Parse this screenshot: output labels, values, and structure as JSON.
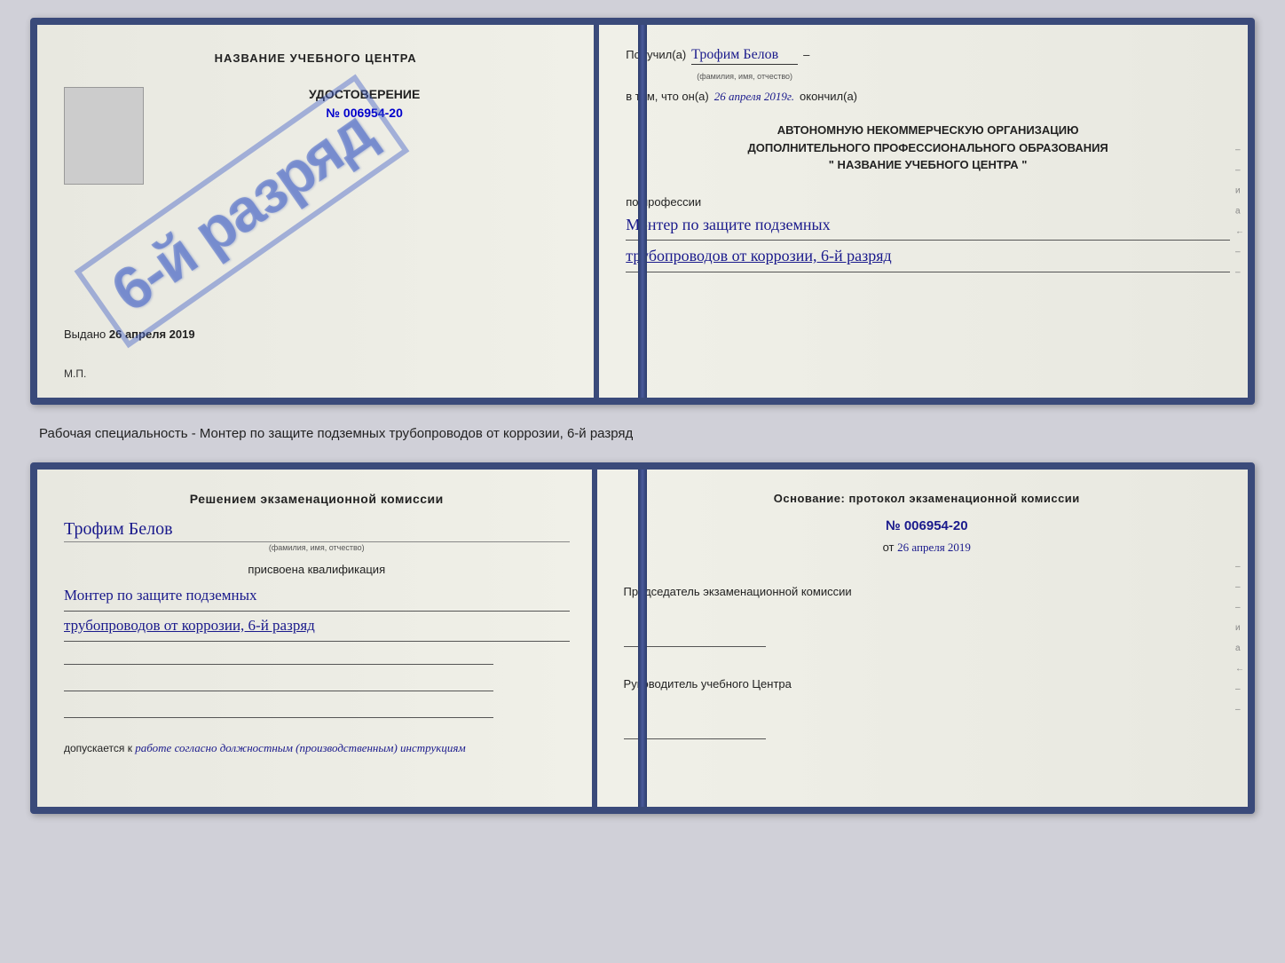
{
  "doc1": {
    "left": {
      "title": "НАЗВАНИЕ УЧЕБНОГО ЦЕНТРА",
      "doc_type": "УДОСТОВЕРЕНИЕ",
      "doc_number_label": "№",
      "doc_number": "006954-20",
      "issued_label": "Выдано",
      "issued_date": "26 апреля 2019",
      "mp_label": "М.П."
    },
    "stamp": {
      "text": "6-й разряд"
    },
    "right": {
      "received_label": "Получил(а)",
      "name": "Трофим Белов",
      "name_annotation": "(фамилия, имя, отчество)",
      "dash": "–",
      "in_that_label": "в том, что он(а)",
      "date": "26 апреля 2019г.",
      "finished_label": "окончил(а)",
      "org_line1": "АВТОНОМНУЮ НЕКОММЕРЧЕСКУЮ ОРГАНИЗАЦИЮ",
      "org_line2": "ДОПОЛНИТЕЛЬНОГО ПРОФЕССИОНАЛЬНОГО ОБРАЗОВАНИЯ",
      "org_line3": "\"   НАЗВАНИЕ УЧЕБНОГО ЦЕНТРА   \"",
      "profession_label": "по профессии",
      "profession1": "Монтер по защите подземных",
      "profession2": "трубопроводов от коррозии, 6-й разряд",
      "edge_marks": [
        "–",
        "–",
        "и",
        "а",
        "←",
        "–",
        "–",
        "–"
      ]
    }
  },
  "separator": {
    "text": "Рабочая специальность - Монтер по защите подземных трубопроводов от коррозии, 6-й разряд"
  },
  "doc2": {
    "left": {
      "commission_label": "Решением экзаменационной комиссии",
      "name": "Трофим Белов",
      "name_annotation": "(фамилия, имя, отчество)",
      "assigned_label": "присвоена квалификация",
      "profession1": "Монтер по защите подземных",
      "profession2": "трубопроводов от коррозии, 6-й разряд",
      "allowed_label": "допускается к",
      "allowed_value": "работе согласно должностным (производственным) инструкциям"
    },
    "right": {
      "osnov_label": "Основание: протокол экзаменационной комиссии",
      "number": "№ 006954-20",
      "date_label": "от",
      "date_value": "26 апреля 2019",
      "chairman_label": "Председатель экзаменационной комиссии",
      "director_label": "Руководитель учебного Центра",
      "edge_marks": [
        "–",
        "–",
        "–",
        "и",
        "а",
        "←",
        "–",
        "–",
        "–"
      ]
    }
  }
}
